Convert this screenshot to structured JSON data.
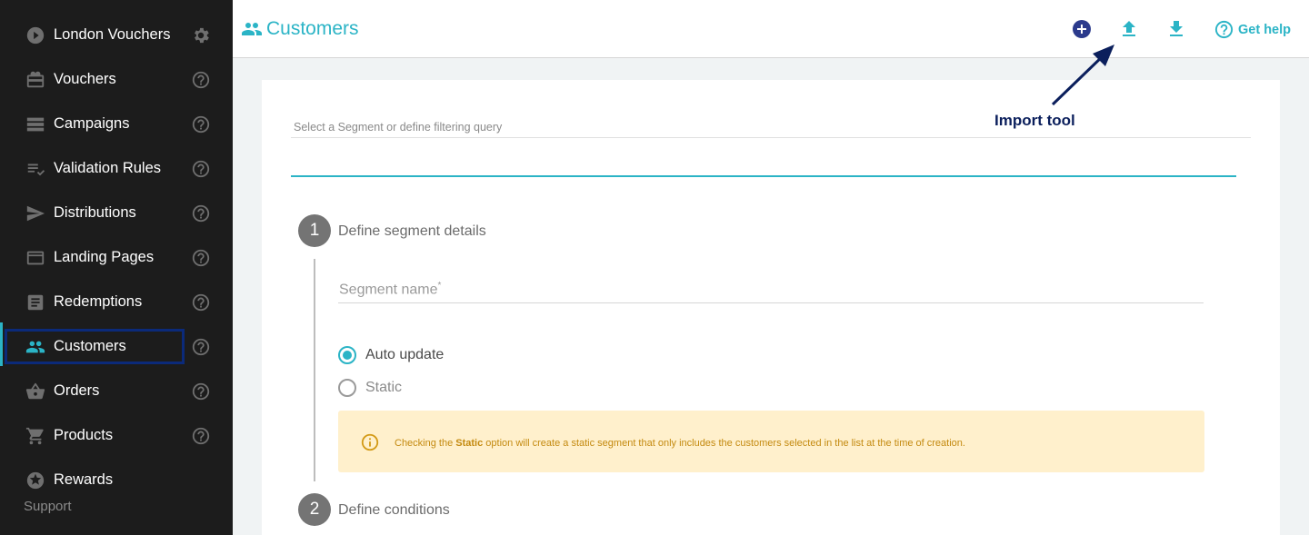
{
  "sidebar": {
    "items": [
      {
        "label": "London Vouchers",
        "icon": "play-circle-icon",
        "right_icon": "gear-icon"
      },
      {
        "label": "Vouchers",
        "icon": "gift-card-icon",
        "right_icon": "help-icon"
      },
      {
        "label": "Campaigns",
        "icon": "list-stack-icon",
        "right_icon": "help-icon"
      },
      {
        "label": "Validation Rules",
        "icon": "rules-check-icon",
        "right_icon": "help-icon"
      },
      {
        "label": "Distributions",
        "icon": "send-icon",
        "right_icon": "help-icon"
      },
      {
        "label": "Landing Pages",
        "icon": "web-page-icon",
        "right_icon": "help-icon"
      },
      {
        "label": "Redemptions",
        "icon": "document-icon",
        "right_icon": "help-icon"
      },
      {
        "label": "Customers",
        "icon": "people-icon",
        "right_icon": "help-icon",
        "active": true
      },
      {
        "label": "Orders",
        "icon": "basket-icon",
        "right_icon": "help-icon"
      },
      {
        "label": "Products",
        "icon": "cart-icon",
        "right_icon": "help-icon"
      },
      {
        "label": "Rewards",
        "icon": "star-badge-icon"
      }
    ],
    "support_label": "Support"
  },
  "header": {
    "title": "Customers",
    "help_label": "Get help"
  },
  "filter": {
    "placeholder": "Select a Segment or define filtering query"
  },
  "steps": [
    {
      "number": "1",
      "label": "Define segment details"
    },
    {
      "number": "2",
      "label": "Define conditions"
    }
  ],
  "segment": {
    "name_placeholder": "Segment name",
    "required_mark": "*",
    "options": [
      {
        "label": "Auto update",
        "checked": true
      },
      {
        "label": "Static",
        "checked": false
      }
    ]
  },
  "info": {
    "prefix": "Checking the ",
    "bold": "Static",
    "suffix": " option will create a static segment that only includes the customers selected in the list at the time of creation."
  },
  "annotation": {
    "label": "Import tool"
  },
  "colors": {
    "accent": "#2bb4c6",
    "sidebar_bg": "#1c1c1c",
    "add_button": "#2b3a8c",
    "highlight_box": "#0b2a7a",
    "info_bg": "#fff0cc",
    "info_text": "#c48a10",
    "annotation": "#0b1f5c"
  }
}
